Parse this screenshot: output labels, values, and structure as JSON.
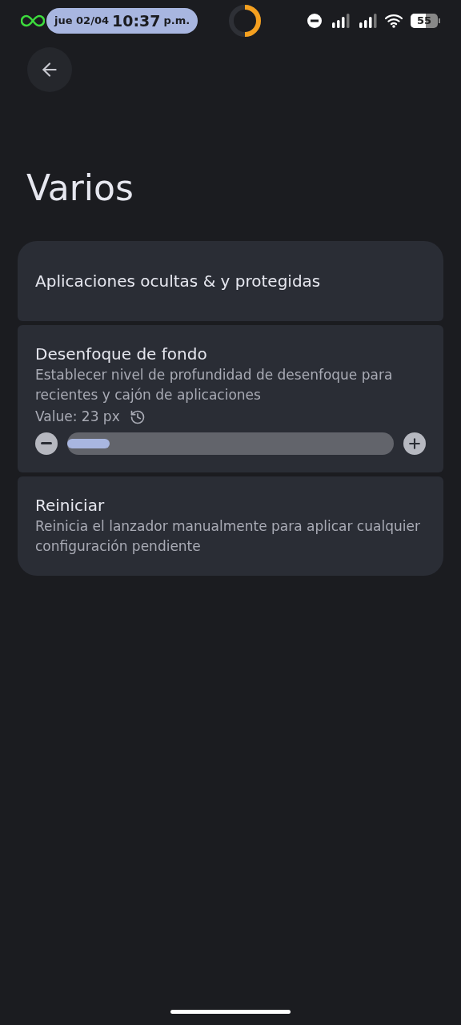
{
  "status_bar": {
    "date": "jue 02/04",
    "time": "10:37",
    "ampm": "p.m.",
    "battery": "55"
  },
  "title": "Varios",
  "settings": [
    {
      "kind": "link",
      "title": "Aplicaciones ocultas & y protegidas"
    },
    {
      "kind": "slider",
      "title": "Desenfoque de fondo",
      "summary": "Establecer nivel de profundidad de desenfoque para recientes y cajón de aplicaciones",
      "value": "Value: 23 px",
      "level": 0.13
    },
    {
      "kind": "text",
      "title": "Reiniciar",
      "summary": "Reinicia el lanzador manualmente para aplicar cualquier configuración pendiente"
    }
  ]
}
